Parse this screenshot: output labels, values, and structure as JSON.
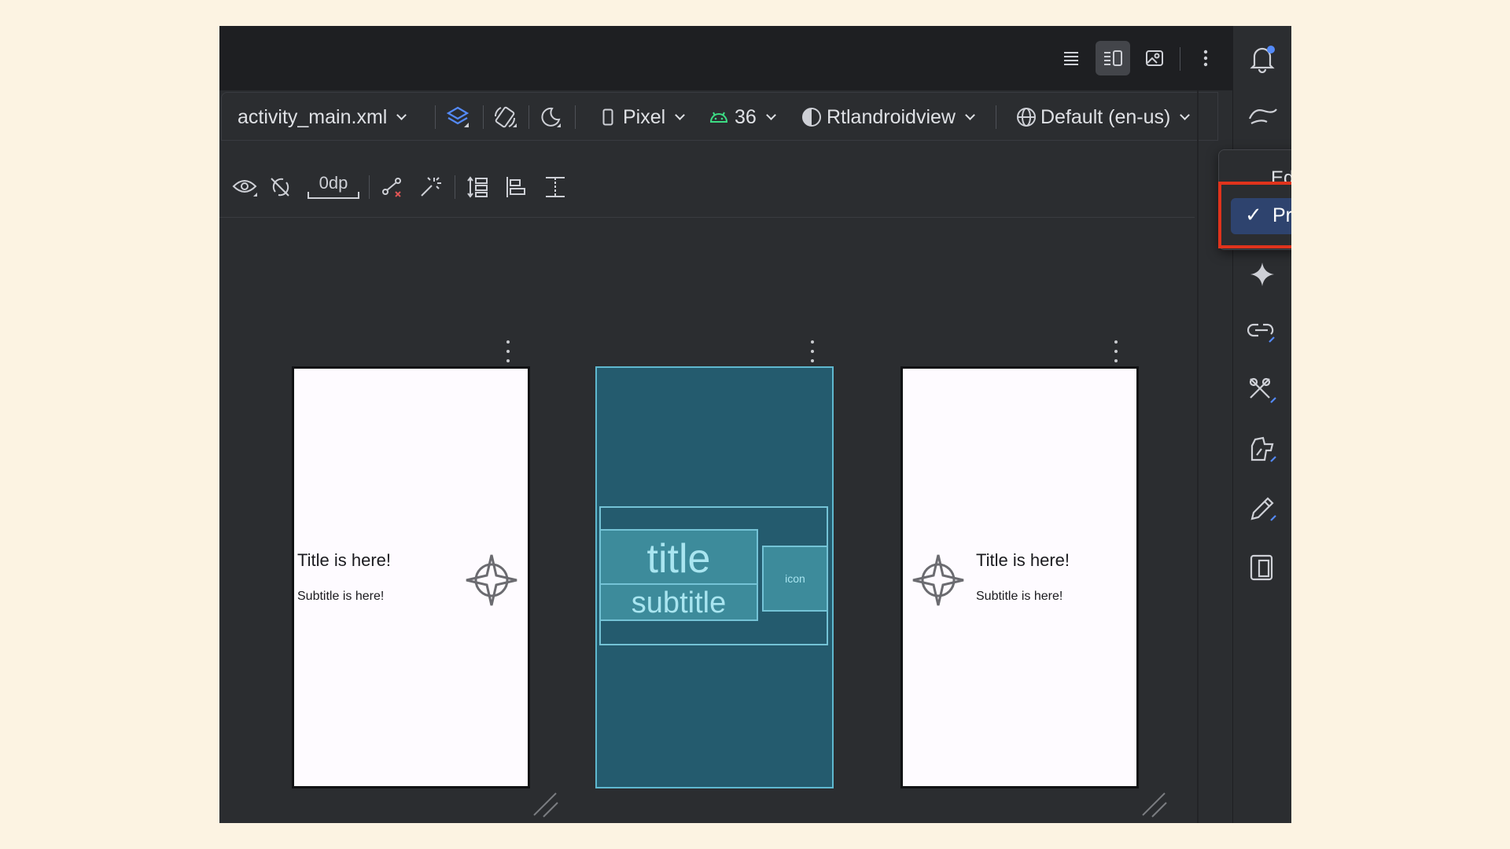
{
  "toolbar": {
    "file": "activity_main.xml",
    "device": "Pixel",
    "api": "36",
    "theme": "Rtlandroidview",
    "locale": "Default (en-us)"
  },
  "toolbar2": {
    "margin": "0dp"
  },
  "dropdown": {
    "edit_translations": "Edit Translations...",
    "preview_rtl": "Preview Right to Left",
    "preview_rtl_checked": true,
    "check": "✓"
  },
  "previews": {
    "left": {
      "title": "Title is here!",
      "subtitle": "Subtitle is here!"
    },
    "blueprint": {
      "title": "title",
      "subtitle": "subtitle",
      "icon": "icon"
    },
    "right": {
      "title": "Title is here!",
      "subtitle": "Subtitle is here!"
    }
  },
  "icons": {
    "top": [
      "code-view-icon",
      "split-view-icon",
      "design-view-icon",
      "more-options-icon"
    ],
    "toolbar1": [
      "design-surface-icon",
      "orientation-icon",
      "night-mode-icon",
      "device-icon",
      "android-icon",
      "theme-icon",
      "globe-icon"
    ],
    "toolbar2": [
      "show-system-ui-icon",
      "autoconnect-icon",
      "infer-constraints-icon",
      "magic-wand-icon",
      "pack-icon",
      "align-icon",
      "guidelines-icon"
    ],
    "sidebar": [
      "notifications-icon",
      "gemini-icon",
      "device-manager-icon",
      "ai-sparkle-icon",
      "link-icon",
      "build-tools-icon",
      "app-quality-icon",
      "edit-icon",
      "running-devices-icon"
    ]
  },
  "colors": {
    "accent": "#548af7",
    "selection": "#2e436e",
    "highlight": "#e0331c",
    "blueprint": "#245b6e"
  }
}
